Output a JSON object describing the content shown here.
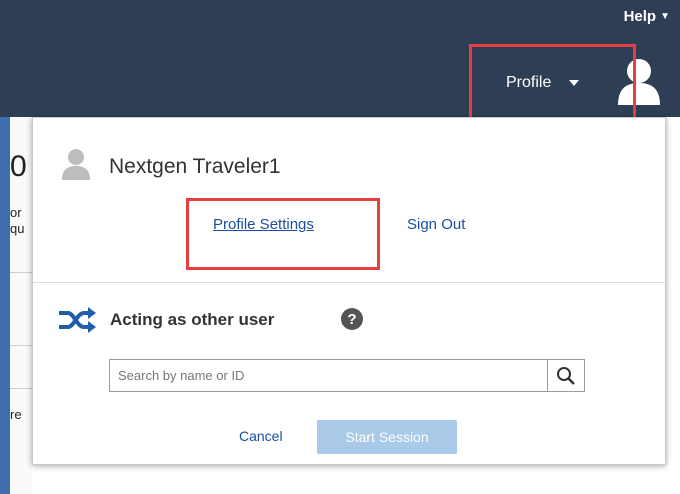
{
  "header": {
    "help_label": "Help",
    "profile_label": "Profile"
  },
  "background": {
    "fragments": [
      "0",
      "or",
      "qu",
      "re"
    ]
  },
  "panel": {
    "user_name": "Nextgen Traveler1",
    "links": {
      "profile_settings": "Profile Settings",
      "sign_out": "Sign Out"
    },
    "acting": {
      "label": "Acting as other user",
      "help_glyph": "?"
    },
    "search": {
      "value": "",
      "placeholder": "Search by name or ID"
    },
    "actions": {
      "cancel": "Cancel",
      "start_session": "Start Session"
    }
  },
  "colors": {
    "topbar": "#2e3f55",
    "link": "#1a4fa0",
    "highlight": "#e5403f",
    "start_button": "#a9c9e8"
  },
  "icons": {
    "avatar": "user-silhouette-icon",
    "shuffle": "shuffle-icon",
    "search": "magnifier-icon",
    "help": "question-circle-icon"
  }
}
